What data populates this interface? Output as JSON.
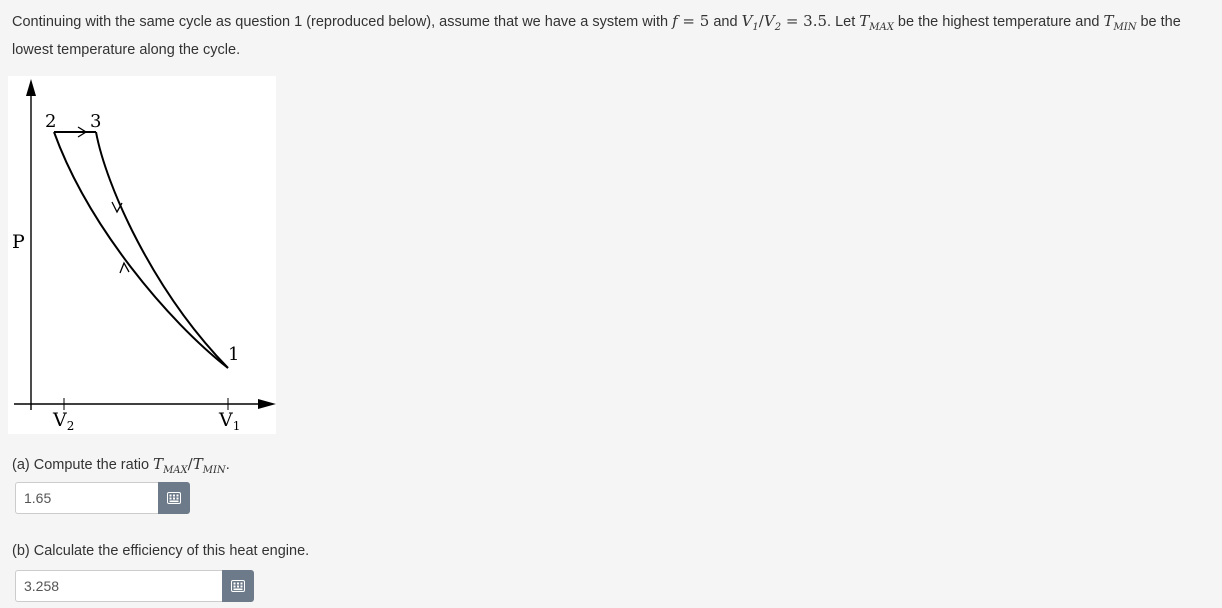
{
  "question": {
    "text_intro": "Continuing with the same cycle as question 1 (reproduced below), assume that we have a system with ",
    "f_var": "f",
    "eq1": " = 5",
    "and": " and ",
    "v1": "V",
    "v1_sub": "1",
    "slash": "/",
    "v2": "V",
    "v2_sub": "2",
    "eq2": " = 3.5",
    "text_mid": ". Let ",
    "tmax": "T",
    "tmax_sub": "MAX",
    "text_mid2": " be the highest temperature and ",
    "tmin": "T",
    "tmin_sub": "MIN",
    "text_end": " be the lowest temperature along the cycle."
  },
  "figure": {
    "y_axis_label": "P",
    "point_labels": [
      "2",
      "3",
      "1"
    ],
    "v2_label": "V",
    "v2_sub": "2",
    "v1_label": "V",
    "v1_sub": "1"
  },
  "part_a": {
    "prefix": "(a) Compute the ratio ",
    "t1": "T",
    "t1_sub": "MAX",
    "slash": "/",
    "t2": "T",
    "t2_sub": "MIN",
    "suffix": ".",
    "answer_value": "1.65",
    "keypad_icon": "keypad-icon"
  },
  "part_b": {
    "label": "(b) Calculate the efficiency of this heat engine.",
    "answer_value": "3.258",
    "keypad_icon": "keypad-icon"
  },
  "colors": {
    "background": "#f5f5f5",
    "text": "#333333",
    "keypad_button": "#6c7a89"
  }
}
